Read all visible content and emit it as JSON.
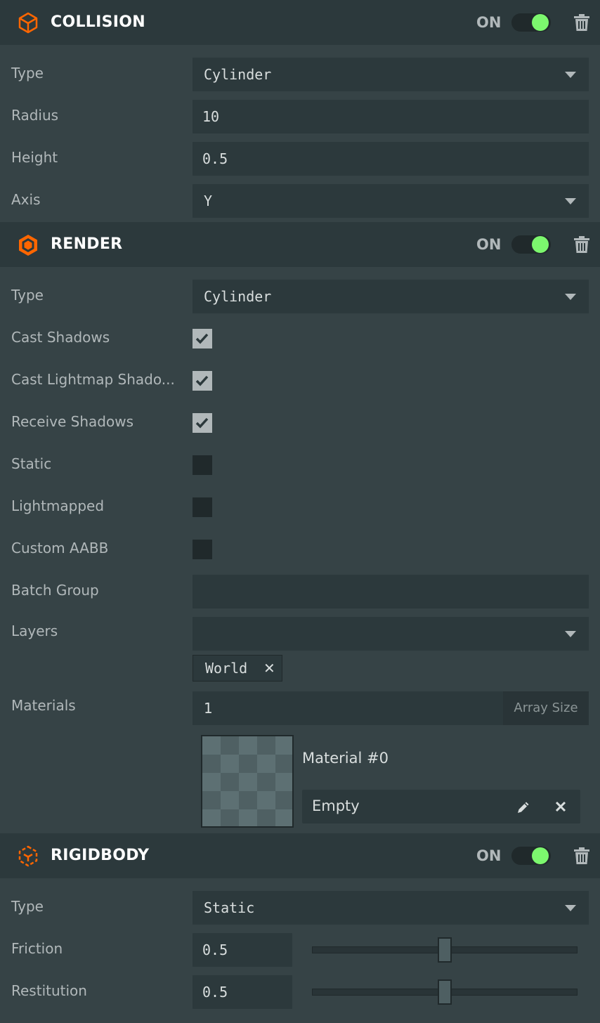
{
  "accent": "#ff6600",
  "toggle_on_color": "#7cf76e",
  "collision": {
    "title": "COLLISION",
    "on_label": "ON",
    "enabled": true,
    "icon": "cube-outline-icon",
    "fields": {
      "type_label": "Type",
      "type_value": "Cylinder",
      "radius_label": "Radius",
      "radius_value": "10",
      "height_label": "Height",
      "height_value": "0.5",
      "axis_label": "Axis",
      "axis_value": "Y"
    }
  },
  "render": {
    "title": "RENDER",
    "on_label": "ON",
    "enabled": true,
    "icon": "hexagon-render-icon",
    "type_label": "Type",
    "type_value": "Cylinder",
    "cast_shadows_label": "Cast Shadows",
    "cast_shadows": true,
    "cast_lightmap_label": "Cast Lightmap Shado...",
    "cast_lightmap": true,
    "receive_shadows_label": "Receive Shadows",
    "receive_shadows": true,
    "static_label": "Static",
    "static": false,
    "lightmapped_label": "Lightmapped",
    "lightmapped": false,
    "custom_aabb_label": "Custom AABB",
    "custom_aabb": false,
    "batch_group_label": "Batch Group",
    "batch_group_value": "",
    "layers_label": "Layers",
    "layers_value": "",
    "layer_tags": [
      "World"
    ],
    "materials_label": "Materials",
    "materials_count": "1",
    "array_size_label": "Array Size",
    "material_name": "Material #0",
    "material_asset": "Empty"
  },
  "rigidbody": {
    "title": "RIGIDBODY",
    "on_label": "ON",
    "enabled": true,
    "icon": "rigidbody-cube-icon",
    "type_label": "Type",
    "type_value": "Static",
    "friction_label": "Friction",
    "friction_value": "0.5",
    "friction_fraction": 0.5,
    "restitution_label": "Restitution",
    "restitution_value": "0.5",
    "restitution_fraction": 0.5
  }
}
